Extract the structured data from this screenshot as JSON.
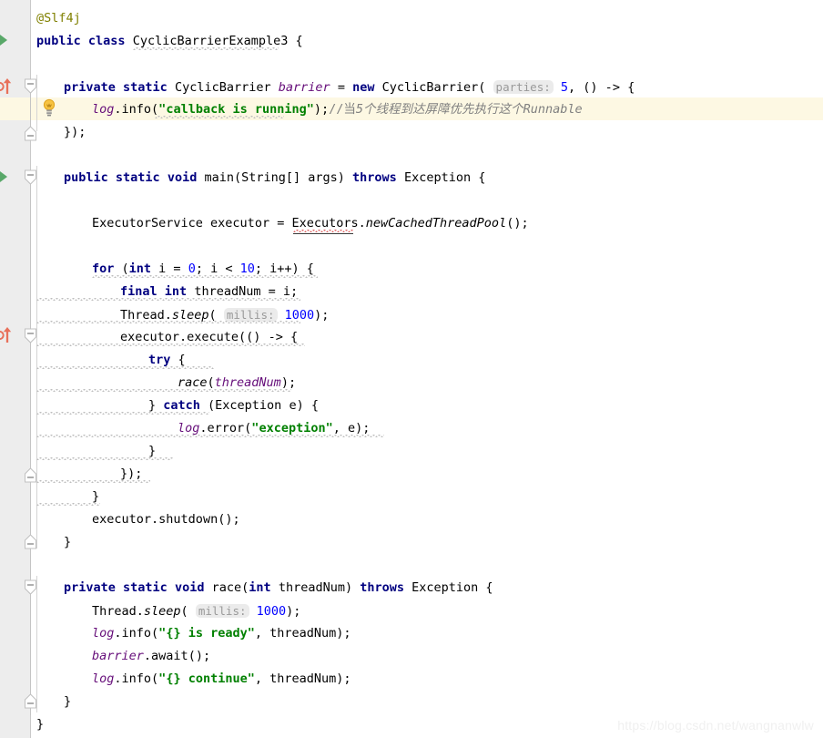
{
  "editor": {
    "language": "java",
    "theme": "IntelliJ Light",
    "colors": {
      "background": "#ffffff",
      "gutter_background": "#ededed",
      "gutter_separator": "#c9c9c9",
      "caret_line_highlight": "#fdf8e3",
      "keyword": "#000080",
      "string": "#008000",
      "number": "#0000ff",
      "annotation": "#808000",
      "field": "#660e7a",
      "comment": "#808080",
      "inlay_hint_background": "#ebebeb",
      "inlay_hint_text": "#999999",
      "run_marker_green": "#59a869",
      "implements_marker_red": "#e8705a",
      "bulb_yellow": "#f5b942"
    },
    "class_name": "CyclicBarrierExample3",
    "caret_line_number": 5
  },
  "gutter": {
    "icons": [
      {
        "name": "run-class-marker",
        "glyph": "run-triangle",
        "line": 2
      },
      {
        "name": "implements-marker",
        "glyph": "implements-arrow",
        "line": 4
      },
      {
        "name": "fold-marker-open",
        "glyph": "fold-collapse",
        "line": 4
      },
      {
        "name": "fold-marker-close",
        "glyph": "fold-end",
        "line": 6
      },
      {
        "name": "run-method-marker",
        "glyph": "run-triangle",
        "line": 8
      },
      {
        "name": "fold-marker-open",
        "glyph": "fold-collapse",
        "line": 8
      },
      {
        "name": "intention-bulb",
        "glyph": "lightbulb",
        "line": 5
      },
      {
        "name": "implements-marker",
        "glyph": "implements-arrow",
        "line": 15
      },
      {
        "name": "fold-marker-open",
        "glyph": "fold-collapse",
        "line": 15
      },
      {
        "name": "fold-marker-close",
        "glyph": "fold-end",
        "line": 21
      },
      {
        "name": "fold-marker-close",
        "glyph": "fold-end",
        "line": 24
      },
      {
        "name": "fold-marker-open",
        "glyph": "fold-collapse",
        "line": 26
      },
      {
        "name": "fold-marker-close",
        "glyph": "fold-end",
        "line": 31
      }
    ]
  },
  "code": {
    "lines": [
      {
        "n": 1,
        "text": "@Slf4j"
      },
      {
        "n": 2,
        "text": "public class CyclicBarrierExample3 {"
      },
      {
        "n": 3,
        "text": ""
      },
      {
        "n": 4,
        "text": "    private static CyclicBarrier barrier = new CyclicBarrier( parties: 5, () -> {"
      },
      {
        "n": 5,
        "text": "        log.info(\"callback is running\");//当5个线程到达屏障优先执行这个Runnable"
      },
      {
        "n": 6,
        "text": "    });"
      },
      {
        "n": 7,
        "text": ""
      },
      {
        "n": 8,
        "text": "    public static void main(String[] args) throws Exception {"
      },
      {
        "n": 9,
        "text": ""
      },
      {
        "n": 10,
        "text": "        ExecutorService executor = Executors.newCachedThreadPool();"
      },
      {
        "n": 11,
        "text": ""
      },
      {
        "n": 12,
        "text": "        for (int i = 0; i < 10; i++) {"
      },
      {
        "n": 13,
        "text": "            final int threadNum = i;"
      },
      {
        "n": 14,
        "text": "            Thread.sleep( millis: 1000);"
      },
      {
        "n": 15,
        "text": "            executor.execute(() -> {"
      },
      {
        "n": 16,
        "text": "                try {"
      },
      {
        "n": 17,
        "text": "                    race(threadNum);"
      },
      {
        "n": 18,
        "text": "                } catch (Exception e) {"
      },
      {
        "n": 19,
        "text": "                    log.error(\"exception\", e);"
      },
      {
        "n": 20,
        "text": "                }"
      },
      {
        "n": 21,
        "text": "            });"
      },
      {
        "n": 22,
        "text": "        }"
      },
      {
        "n": 23,
        "text": "        executor.shutdown();"
      },
      {
        "n": 24,
        "text": "    }"
      },
      {
        "n": 25,
        "text": ""
      },
      {
        "n": 26,
        "text": "    private static void race(int threadNum) throws Exception {"
      },
      {
        "n": 27,
        "text": "        Thread.sleep( millis: 1000);"
      },
      {
        "n": 28,
        "text": "        log.info(\"{} is ready\", threadNum);"
      },
      {
        "n": 29,
        "text": "        barrier.await();"
      },
      {
        "n": 30,
        "text": "        log.info(\"{} continue\", threadNum);"
      },
      {
        "n": 31,
        "text": "    }"
      },
      {
        "n": 32,
        "text": "}"
      }
    ],
    "tokens": {
      "annotation_slf4j": "@Slf4j",
      "kw_public": "public",
      "kw_class": "class",
      "kw_private": "private",
      "kw_static": "static",
      "kw_void": "void",
      "kw_new": "new",
      "kw_throws": "throws",
      "kw_int": "int",
      "kw_final": "final",
      "kw_for": "for",
      "kw_try": "try",
      "kw_catch": "catch",
      "type_cyclic_barrier": "CyclicBarrier",
      "var_barrier": "barrier",
      "var_log": "log",
      "var_executor": "executor",
      "var_thread_num": "threadNum",
      "method_race": "race",
      "method_await": "await",
      "method_shutdown": "shutdown",
      "method_new_cached_thread_pool": "newCachedThreadPool",
      "method_sleep": "sleep",
      "str_callback": "callback is running",
      "str_exception": "exception",
      "str_is_ready": "{} is ready",
      "str_continue": "{} continue",
      "comment_cn": "//当5个线程到达屏障优先执行这个Runnable",
      "hint_parties": "parties:",
      "hint_millis": "millis:",
      "num_5": "5",
      "num_0": "0",
      "num_10": "10",
      "num_1000": "1000"
    }
  },
  "watermark": {
    "text": "https://blog.csdn.net/wangnanwlw"
  }
}
